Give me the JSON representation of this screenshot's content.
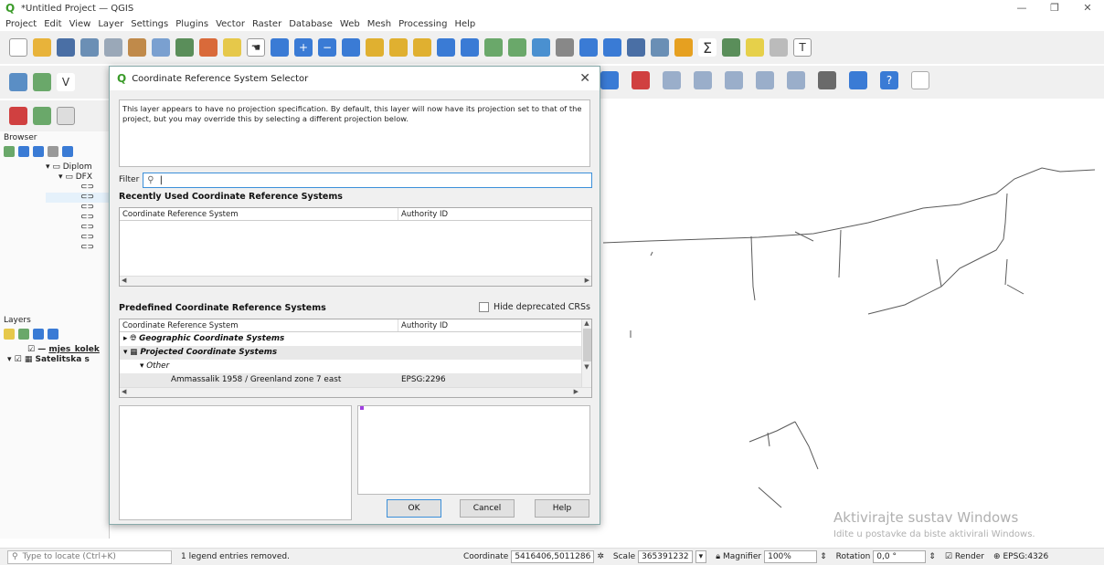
{
  "window": {
    "title": "*Untitled Project — QGIS",
    "controls": [
      "—",
      "❐",
      "✕"
    ]
  },
  "menu": [
    "Project",
    "Edit",
    "View",
    "Layer",
    "Settings",
    "Plugins",
    "Vector",
    "Raster",
    "Database",
    "Web",
    "Mesh",
    "Processing",
    "Help"
  ],
  "browser": {
    "title": "Browser",
    "items": [
      "Diplom",
      "DFX",
      "",
      "",
      "",
      "",
      "",
      "",
      ""
    ]
  },
  "layers": {
    "title": "Layers",
    "items": [
      "mjes_kolek",
      "Satelitska s"
    ]
  },
  "dialog": {
    "title": "Coordinate Reference System Selector",
    "message": "This layer appears to have no projection specification. By default, this layer will now have its projection set to that of the project, but you may override this by selecting a different projection below.",
    "filter_label": "Filter",
    "filter_value": "",
    "recent_title": "Recently Used Coordinate Reference Systems",
    "col_crs": "Coordinate Reference System",
    "col_auth": "Authority ID",
    "predefined_title": "Predefined Coordinate Reference Systems",
    "hide_deprecated": "Hide deprecated CRSs",
    "tree": [
      {
        "label": "Geographic Coordinate Systems",
        "auth": "",
        "level": 0,
        "bold": true
      },
      {
        "label": "Projected Coordinate Systems",
        "auth": "",
        "level": 0,
        "bold": true
      },
      {
        "label": "Other",
        "auth": "",
        "level": 1,
        "bold": false
      },
      {
        "label": "Ammassalik 1958 / Greenland zone 7 east",
        "auth": "EPSG:2296",
        "level": 2,
        "bold": false
      }
    ],
    "ok": "OK",
    "cancel": "Cancel",
    "help": "Help"
  },
  "watermark": {
    "line1": "Aktivirajte sustav Windows",
    "line2": "Idite u postavke da biste aktivirali Windows."
  },
  "status": {
    "locate_placeholder": "Type to locate (Ctrl+K)",
    "message": "1 legend entries removed.",
    "coordinate_label": "Coordinate",
    "coordinate": "5416406,5011286",
    "scale_label": "Scale",
    "scale": "365391232",
    "magnifier_label": "Magnifier",
    "magnifier": "100%",
    "rotation_label": "Rotation",
    "rotation": "0,0 °",
    "render_label": "Render",
    "crs": "EPSG:4326"
  }
}
